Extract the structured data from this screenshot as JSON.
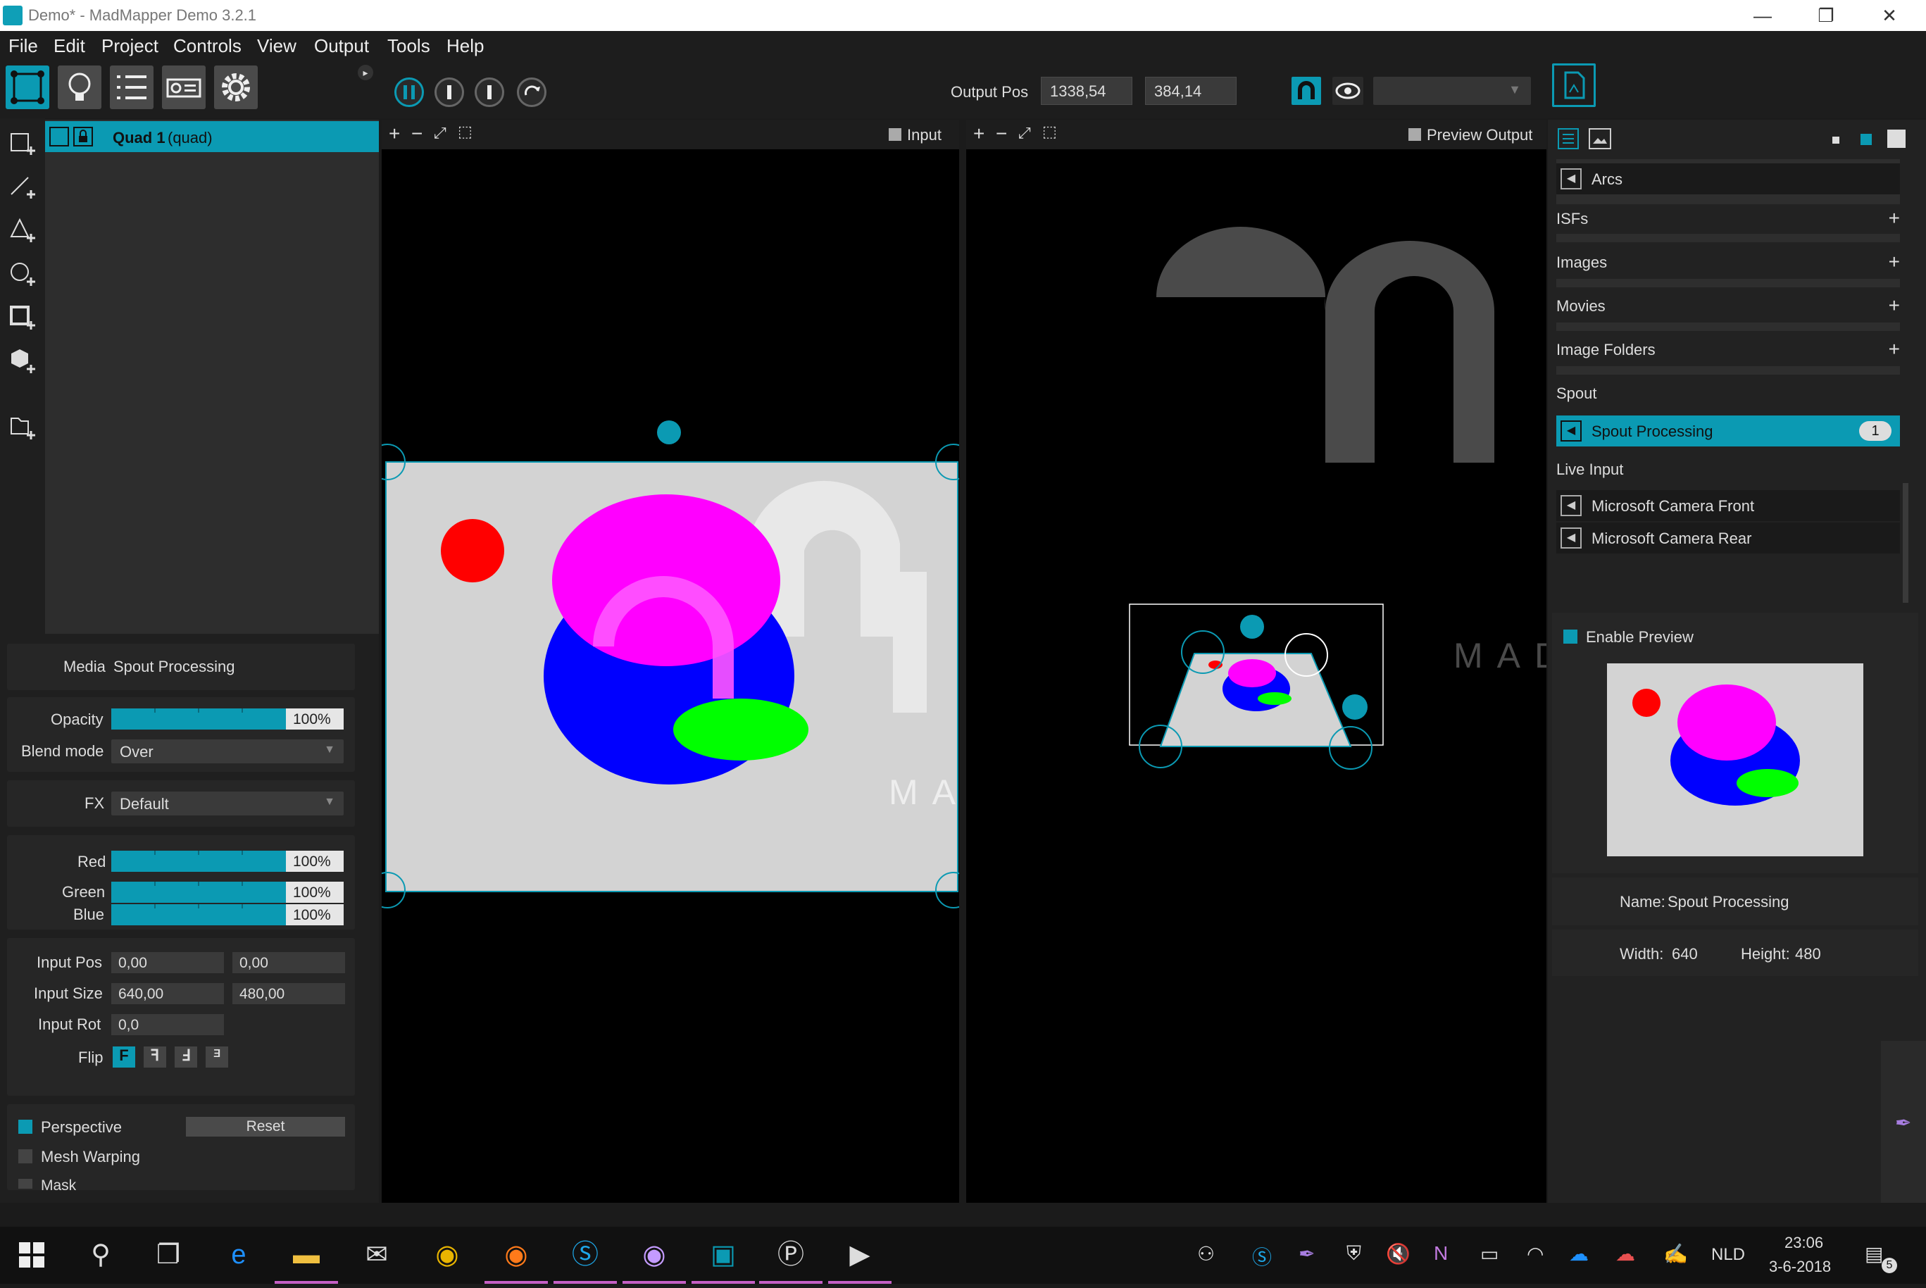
{
  "window": {
    "title": "Demo* - MadMapper Demo 3.2.1",
    "min_icon": "minimize-icon",
    "max_icon": "restore-icon",
    "close_icon": "close-icon",
    "min_glyph": "—",
    "max_glyph": "❐",
    "close_glyph": "✕"
  },
  "menu": [
    "File",
    "Edit",
    "Project",
    "Controls",
    "View",
    "Output",
    "Tools",
    "Help"
  ],
  "toolbar": {
    "output_pos_label": "Output Pos",
    "output_pos_x": "1338,54",
    "output_pos_y": "384,14",
    "accent": "#0b9ab3"
  },
  "layers": {
    "name": "Quad 1",
    "type": "(quad)"
  },
  "properties": {
    "media_label": "Media",
    "media_value": "Spout Processing",
    "opacity_label": "Opacity",
    "opacity_value": "100%",
    "opacity_level": 1.0,
    "blend_label": "Blend mode",
    "blend_value": "Over",
    "fx_label": "FX",
    "fx_value": "Default",
    "red_label": "Red",
    "red_value": "100%",
    "green_label": "Green",
    "green_value": "100%",
    "blue_label": "Blue",
    "blue_value": "100%",
    "input_pos_label": "Input Pos",
    "input_pos_x": "0,00",
    "input_pos_y": "0,00",
    "input_size_label": "Input Size",
    "input_size_w": "640,00",
    "input_size_h": "480,00",
    "input_rot_label": "Input Rot",
    "input_rot_value": "0,0",
    "flip_label": "Flip",
    "flip_glyphs": [
      "F",
      "ꟻ",
      "Ⅎ",
      "ᴲ"
    ],
    "perspective_label": "Perspective",
    "reset_label": "Reset",
    "mesh_label": "Mesh Warping",
    "mask_label": "Mask"
  },
  "input_view": {
    "title": "Input",
    "watermark": "MA"
  },
  "output_view": {
    "title": "Preview Output",
    "watermark": "MAD"
  },
  "library": {
    "arcs": "Arcs",
    "isfs": "ISFs",
    "images": "Images",
    "movies": "Movies",
    "image_folders": "Image Folders",
    "spout": "Spout",
    "spout_item": "Spout Processing",
    "spout_count": "1",
    "live_input": "Live Input",
    "cam_front": "Microsoft Camera Front",
    "cam_rear": "Microsoft Camera Rear",
    "enable_preview": "Enable Preview",
    "name_label": "Name:",
    "name_value": "Spout Processing",
    "width_label": "Width:",
    "width_value": "640",
    "height_label": "Height:",
    "height_value": "480"
  },
  "taskbar": {
    "language": "NLD",
    "time": "23:06",
    "date": "3-6-2018",
    "notification_count": "5"
  }
}
